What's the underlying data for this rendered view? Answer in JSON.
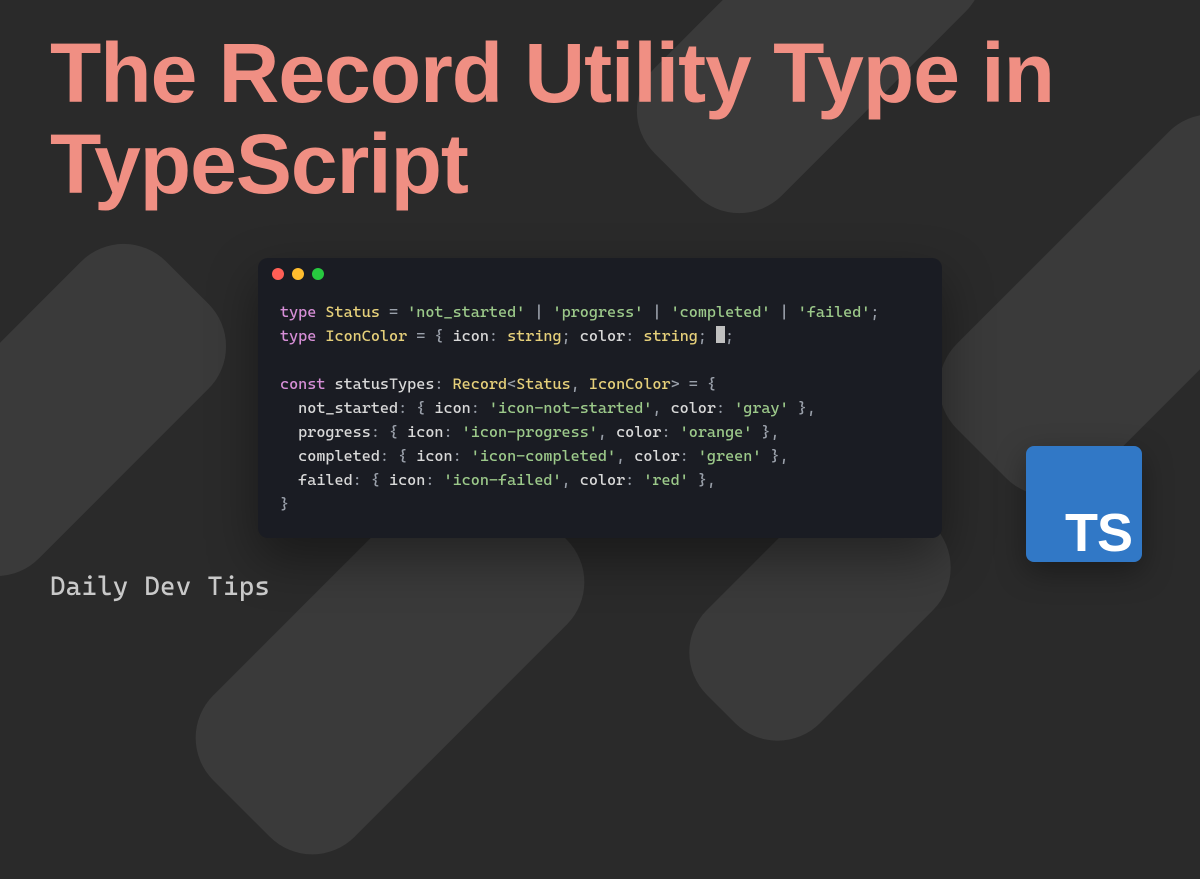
{
  "title": "The Record Utility Type in TypeScript",
  "footer": "Daily Dev Tips",
  "ts_logo_text": "TS",
  "code": {
    "line1": {
      "kw": "type",
      "name": "Status",
      "eq": " = ",
      "v1": "'not_started'",
      "pipe": " | ",
      "v2": "'progress'",
      "v3": "'completed'",
      "v4": "'failed'",
      "semi": ";"
    },
    "line2": {
      "kw": "type",
      "name": "IconColor",
      "eq": " = { ",
      "p1": "icon",
      "c1": ": ",
      "t1": "string",
      "sc": "; ",
      "p2": "color",
      "t2": "string",
      "close": ";"
    },
    "line4": {
      "kw": "const",
      "name": "statusTypes",
      "colon": ": ",
      "rec": "Record",
      "lt": "<",
      "a1": "Status",
      "comma": ", ",
      "a2": "IconColor",
      "gt": ">",
      "eq": " = {"
    },
    "entries": [
      {
        "key": "not_started",
        "icon": "'icon-not-started'",
        "color": "'gray'"
      },
      {
        "key": "progress",
        "icon": "'icon-progress'",
        "color": "'orange'"
      },
      {
        "key": "completed",
        "icon": "'icon-completed'",
        "color": "'green'"
      },
      {
        "key": "failed",
        "icon": "'icon-failed'",
        "color": "'red'"
      }
    ],
    "entry_labels": {
      "icon": "icon",
      "color": "color",
      "open": ": { ",
      "mid": ": ",
      "sep": ", ",
      "close": " },"
    },
    "close_brace": "}"
  }
}
